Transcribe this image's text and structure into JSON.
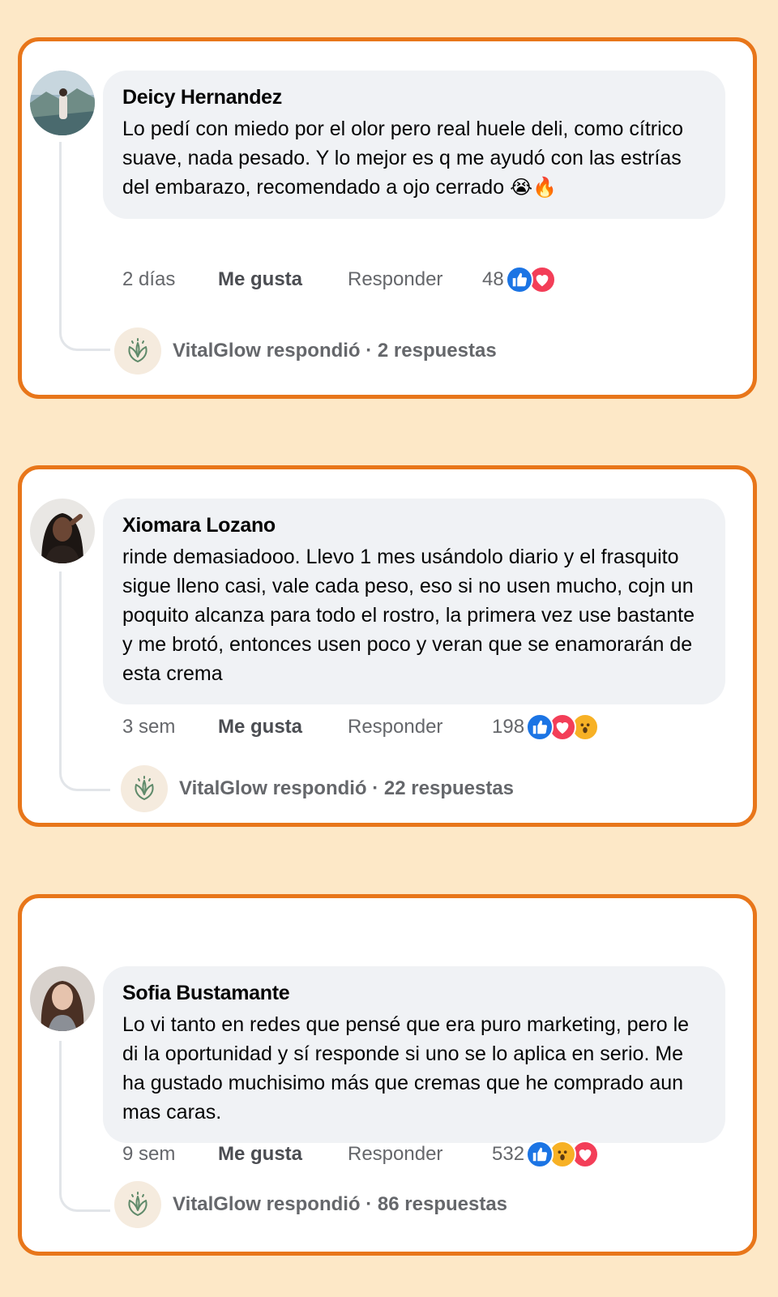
{
  "comments": [
    {
      "author": "Deicy Hernandez",
      "text": "Lo pedí con miedo por el olor pero real huele deli, como cítrico suave, nada pesado. Y lo mejor es q me ayudó con las estrías del embarazo, recomendado a ojo cerrado",
      "emojis": "😭🔥",
      "time": "2 días",
      "like_label": "Me gusta",
      "reply_label": "Responder",
      "reaction_count": "48",
      "reactions": [
        "like-icon",
        "love-icon"
      ],
      "replies_text": "VitalGlow respondió · 2 respuestas"
    },
    {
      "author": "Xiomara Lozano",
      "text": "rinde demasiadooo. Llevo 1 mes usándolo diario y el frasquito sigue lleno casi, vale cada peso, eso si no usen mucho, cojn un poquito alcanza para todo el rostro, la primera vez use bastante y me brotó, entonces usen poco y veran que se enamorarán de esta crema",
      "time": "3 sem",
      "like_label": "Me gusta",
      "reply_label": "Responder",
      "reaction_count": "198",
      "reactions": [
        "like-icon",
        "love-icon",
        "wow-icon"
      ],
      "replies_text": "VitalGlow respondió · 22 respuestas"
    },
    {
      "author": "Sofia Bustamante",
      "text": "Lo vi tanto en redes que pensé que era puro marketing, pero le di la oportunidad y sí responde si uno se lo aplica en serio. Me ha gustado muchisimo más que cremas que he comprado aun mas caras.",
      "time": "9 sem",
      "like_label": "Me gusta",
      "reply_label": "Responder",
      "reaction_count": "532",
      "reactions": [
        "like-icon",
        "wow-icon",
        "love-icon"
      ],
      "replies_text": "VitalGlow respondió · 86 respuestas"
    }
  ],
  "colors": {
    "background": "#fde8c7",
    "card_border": "#e8761a",
    "bubble": "#f0f2f5",
    "like_blue": "#1b74e4",
    "love_red": "#f33e58",
    "wow_yellow": "#f7b125",
    "brand_green": "#5f8a6a"
  }
}
